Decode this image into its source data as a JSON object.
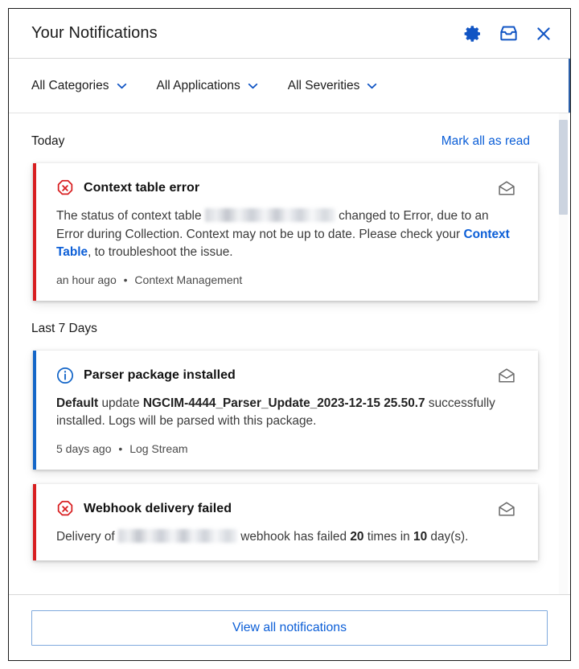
{
  "header": {
    "title": "Your Notifications",
    "icons": [
      {
        "name": "settings-gear-icon",
        "label": "Settings"
      },
      {
        "name": "inbox-icon",
        "label": "Inbox"
      },
      {
        "name": "close-icon",
        "label": "Close"
      }
    ]
  },
  "filters": [
    {
      "label": "All Categories",
      "name": "filter-all-categories"
    },
    {
      "label": "All Applications",
      "name": "filter-all-applications"
    },
    {
      "label": "All Severities",
      "name": "filter-all-severities"
    }
  ],
  "sections": [
    {
      "title": "Today",
      "action": "Mark all as read"
    },
    {
      "title": "Last 7 Days",
      "action": ""
    }
  ],
  "notifications": [
    {
      "severity": "error",
      "title": "Context table error",
      "body_parts": [
        {
          "type": "text",
          "text": "The status of context table "
        },
        {
          "type": "redacted",
          "width": 162
        },
        {
          "type": "text",
          "text": " changed to Error, due to an Error during Collection. Context may not be up to date. Please check your "
        },
        {
          "type": "link",
          "text": "Context Table"
        },
        {
          "type": "text",
          "text": ", to troubleshoot the issue."
        }
      ],
      "time": "an hour ago",
      "separator": "•",
      "source": "Context Management",
      "envelope": "envelope-open-icon"
    },
    {
      "severity": "info",
      "title": "Parser package installed",
      "body_parts": [
        {
          "type": "bold",
          "text": "Default"
        },
        {
          "type": "text",
          "text": " update "
        },
        {
          "type": "bold",
          "text": "NGCIM-4444_Parser_Update_2023-12-15 25.50.7"
        },
        {
          "type": "text",
          "text": " successfully installed. Logs will be parsed with this package."
        }
      ],
      "time": "5 days ago",
      "separator": "•",
      "source": "Log Stream",
      "envelope": "envelope-open-icon"
    },
    {
      "severity": "error",
      "title": "Webhook delivery failed",
      "body_parts": [
        {
          "type": "text",
          "text": "Delivery of "
        },
        {
          "type": "redacted",
          "width": 148
        },
        {
          "type": "text",
          "text": " webhook has failed "
        },
        {
          "type": "bold",
          "text": "20"
        },
        {
          "type": "text",
          "text": " times in "
        },
        {
          "type": "bold",
          "text": "10"
        },
        {
          "type": "text",
          "text": " day(s)."
        }
      ],
      "time": "",
      "separator": "",
      "source": "",
      "envelope": "envelope-open-icon"
    }
  ],
  "footer": {
    "view_all_label": "View all notifications"
  },
  "colors": {
    "accent_blue": "#0b5ed7",
    "error_red": "#d81e20",
    "info_blue": "#1466c8",
    "icon_blue": "#1155c4",
    "envelope_gray": "#6b6b6b",
    "scrollbar_thumb": "#ccd4e0",
    "filter_edge_blue": "#2b5fa8"
  }
}
